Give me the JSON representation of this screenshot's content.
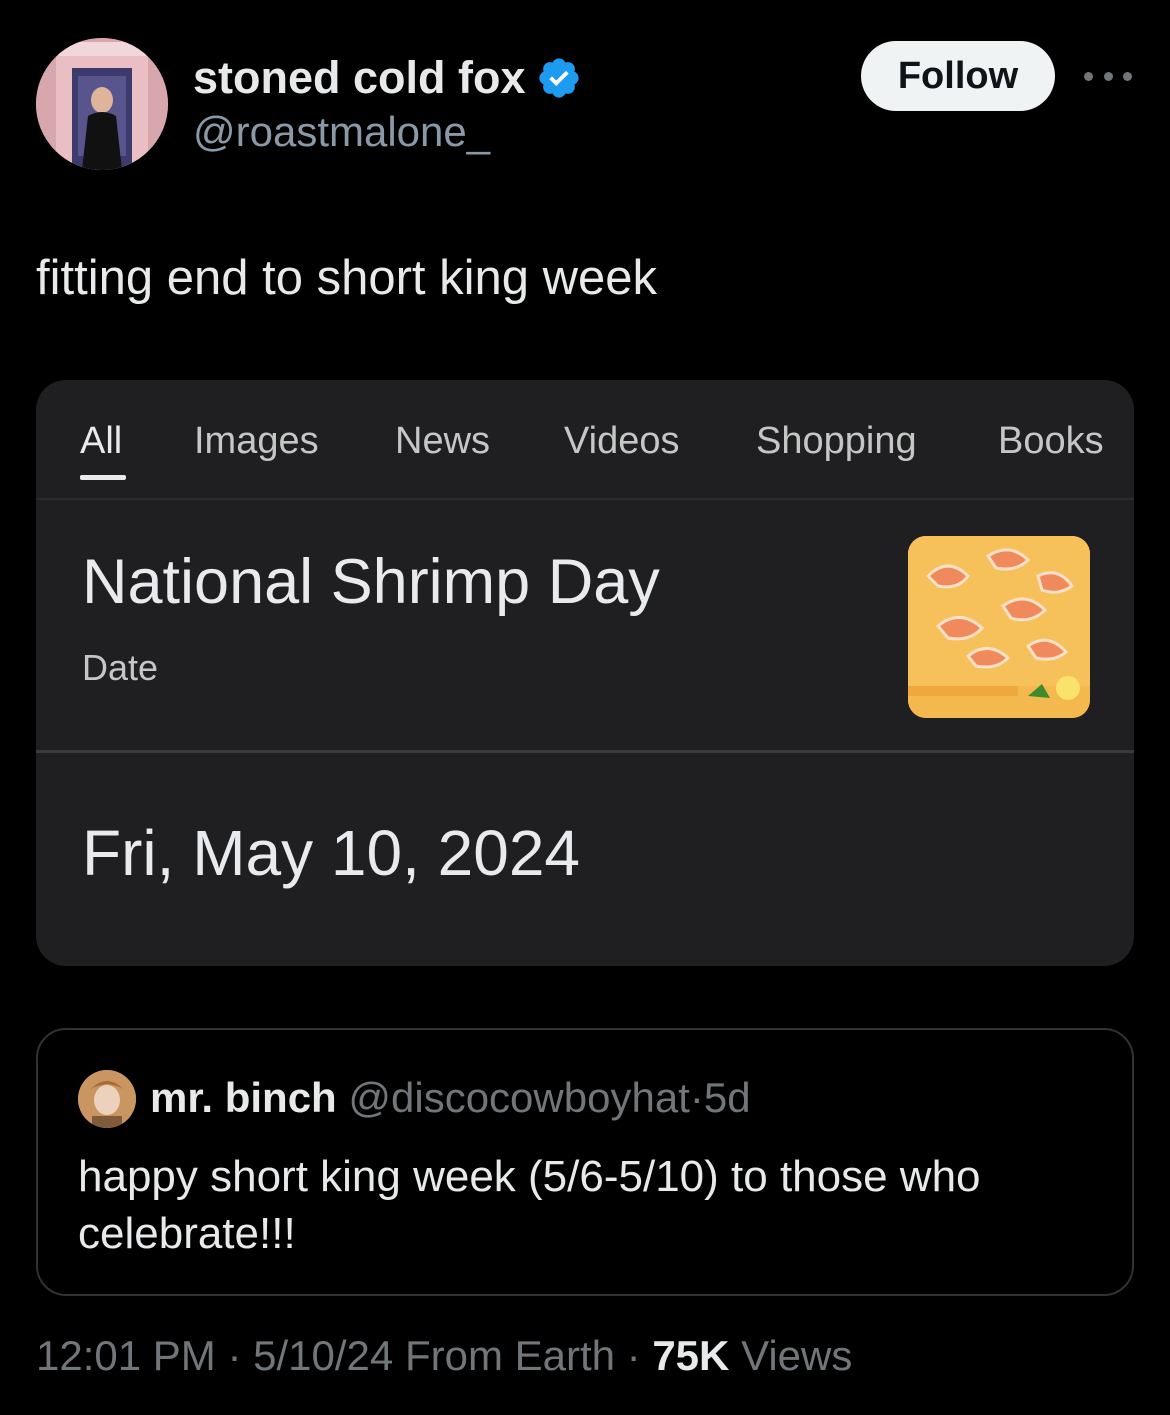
{
  "author": {
    "display_name": "stoned cold fox",
    "handle": "@roastmalone_",
    "verified": true
  },
  "actions": {
    "follow_label": "Follow",
    "more_icon": "more-horizontal-icon"
  },
  "tweet": {
    "text": "fitting end to short king week"
  },
  "search_card": {
    "tabs": [
      {
        "label": "All",
        "active": true
      },
      {
        "label": "Images"
      },
      {
        "label": "News"
      },
      {
        "label": "Videos"
      },
      {
        "label": "Shopping"
      },
      {
        "label": "Books"
      }
    ],
    "title": "National Shrimp Day",
    "subtitle": "Date",
    "date": "Fri, May 10, 2024",
    "thumbnail": "shrimp-photo"
  },
  "quoted_tweet": {
    "display_name": "mr. binch",
    "handle": "@discocowboyhat",
    "separator": "·",
    "time": "5d",
    "text": "happy short king week (5/6-5/10) to those who celebrate!!!"
  },
  "meta": {
    "time": "12:01 PM",
    "separator_1": "·",
    "date": "5/10/24",
    "location": "From Earth",
    "separator_2": "·",
    "views_count": "75K",
    "views_label": "Views"
  },
  "colors": {
    "background": "#000000",
    "card": "#1f1f21",
    "verified": "#1d9bf0",
    "muted": "#71767b",
    "follow_bg": "#eff3f4"
  }
}
